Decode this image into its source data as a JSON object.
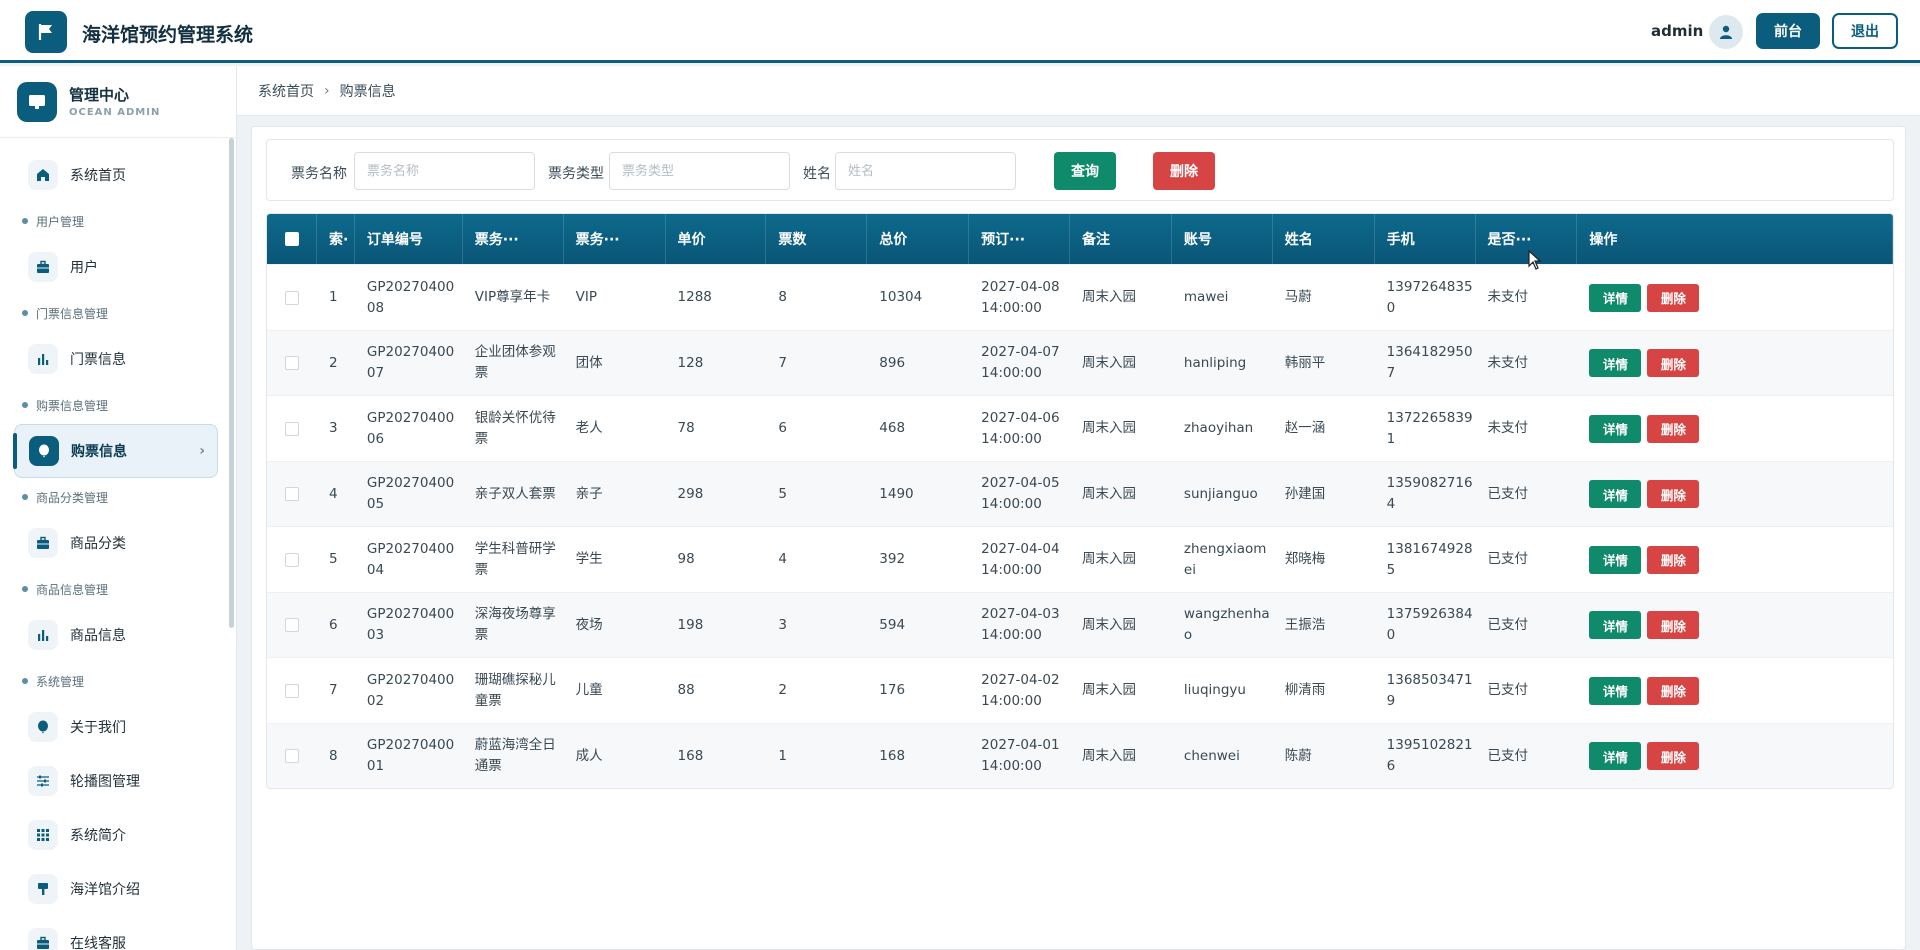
{
  "header": {
    "app_title": "海洋馆预约管理系统",
    "admin_name": "admin",
    "front_label": "前台",
    "exit_label": "退出"
  },
  "sidebar": {
    "title": "管理中心",
    "subtitle": "OCEAN ADMIN",
    "entries": [
      {
        "kind": "item",
        "label": "系统首页",
        "icon": "home-icon"
      },
      {
        "kind": "group",
        "label": "用户管理"
      },
      {
        "kind": "item",
        "label": "用户",
        "icon": "briefcase-icon"
      },
      {
        "kind": "group",
        "label": "门票信息管理"
      },
      {
        "kind": "item",
        "label": "门票信息",
        "icon": "bar-chart-icon"
      },
      {
        "kind": "group",
        "label": "购票信息管理"
      },
      {
        "kind": "item",
        "label": "购票信息",
        "icon": "balloon-icon",
        "active": true
      },
      {
        "kind": "group",
        "label": "商品分类管理"
      },
      {
        "kind": "item",
        "label": "商品分类",
        "icon": "briefcase-icon"
      },
      {
        "kind": "group",
        "label": "商品信息管理"
      },
      {
        "kind": "item",
        "label": "商品信息",
        "icon": "bar-chart-icon"
      },
      {
        "kind": "group",
        "label": "系统管理"
      },
      {
        "kind": "item",
        "label": "关于我们",
        "icon": "balloon-icon"
      },
      {
        "kind": "item",
        "label": "轮播图管理",
        "icon": "sliders-icon"
      },
      {
        "kind": "item",
        "label": "系统简介",
        "icon": "grid-icon"
      },
      {
        "kind": "item",
        "label": "海洋馆介绍",
        "icon": "brush-icon"
      },
      {
        "kind": "item",
        "label": "在线客服",
        "icon": "briefcase-icon"
      }
    ]
  },
  "breadcrumb": {
    "home": "系统首页",
    "current": "购票信息"
  },
  "search": {
    "ticket_name_label": "票务名称",
    "ticket_name_placeholder": "票务名称",
    "ticket_type_label": "票务类型",
    "ticket_type_placeholder": "票务类型",
    "name_label": "姓名",
    "name_placeholder": "姓名",
    "query_label": "查询",
    "delete_label": "删除"
  },
  "table": {
    "headers": [
      "",
      "索·",
      "订单编号",
      "票务···",
      "票务···",
      "单价",
      "票数",
      "总价",
      "预订···",
      "备注",
      "账号",
      "姓名",
      "手机",
      "是否···",
      "操作"
    ],
    "detail_label": "详情",
    "remove_label": "删除",
    "rows": [
      {
        "idx": "1",
        "order": "GP2027040008",
        "ticket_name": "VIP尊享年卡",
        "ticket_type": "VIP",
        "price": "1288",
        "count": "8",
        "total": "10304",
        "date": "2027-04-08 14:00:00",
        "note": "周末入园",
        "account": "mawei",
        "name": "马蔚",
        "phone": "13972648350",
        "paid": "未支付"
      },
      {
        "idx": "2",
        "order": "GP2027040007",
        "ticket_name": "企业团体参观票",
        "ticket_type": "团体",
        "price": "128",
        "count": "7",
        "total": "896",
        "date": "2027-04-07 14:00:00",
        "note": "周末入园",
        "account": "hanliping",
        "name": "韩丽平",
        "phone": "13641829507",
        "paid": "未支付"
      },
      {
        "idx": "3",
        "order": "GP2027040006",
        "ticket_name": "银龄关怀优待票",
        "ticket_type": "老人",
        "price": "78",
        "count": "6",
        "total": "468",
        "date": "2027-04-06 14:00:00",
        "note": "周末入园",
        "account": "zhaoyihan",
        "name": "赵一涵",
        "phone": "13722658391",
        "paid": "未支付"
      },
      {
        "idx": "4",
        "order": "GP2027040005",
        "ticket_name": "亲子双人套票",
        "ticket_type": "亲子",
        "price": "298",
        "count": "5",
        "total": "1490",
        "date": "2027-04-05 14:00:00",
        "note": "周末入园",
        "account": "sunjianguo",
        "name": "孙建国",
        "phone": "13590827164",
        "paid": "已支付"
      },
      {
        "idx": "5",
        "order": "GP2027040004",
        "ticket_name": "学生科普研学票",
        "ticket_type": "学生",
        "price": "98",
        "count": "4",
        "total": "392",
        "date": "2027-04-04 14:00:00",
        "note": "周末入园",
        "account": "zhengxiaomei",
        "name": "郑晓梅",
        "phone": "13816749285",
        "paid": "已支付"
      },
      {
        "idx": "6",
        "order": "GP2027040003",
        "ticket_name": "深海夜场尊享票",
        "ticket_type": "夜场",
        "price": "198",
        "count": "3",
        "total": "594",
        "date": "2027-04-03 14:00:00",
        "note": "周末入园",
        "account": "wangzhenhao",
        "name": "王振浩",
        "phone": "13759263840",
        "paid": "已支付"
      },
      {
        "idx": "7",
        "order": "GP2027040002",
        "ticket_name": "珊瑚礁探秘儿童票",
        "ticket_type": "儿童",
        "price": "88",
        "count": "2",
        "total": "176",
        "date": "2027-04-02 14:00:00",
        "note": "周末入园",
        "account": "liuqingyu",
        "name": "柳清雨",
        "phone": "13685034719",
        "paid": "已支付"
      },
      {
        "idx": "8",
        "order": "GP2027040001",
        "ticket_name": "蔚蓝海湾全日通票",
        "ticket_type": "成人",
        "price": "168",
        "count": "1",
        "total": "168",
        "date": "2027-04-01 14:00:00",
        "note": "周末入园",
        "account": "chenwei",
        "name": "陈蔚",
        "phone": "13951028216",
        "paid": "已支付"
      }
    ]
  },
  "colors": {
    "primary": "#0b5d7e",
    "success": "#0f8a6a",
    "danger": "#d64543"
  }
}
